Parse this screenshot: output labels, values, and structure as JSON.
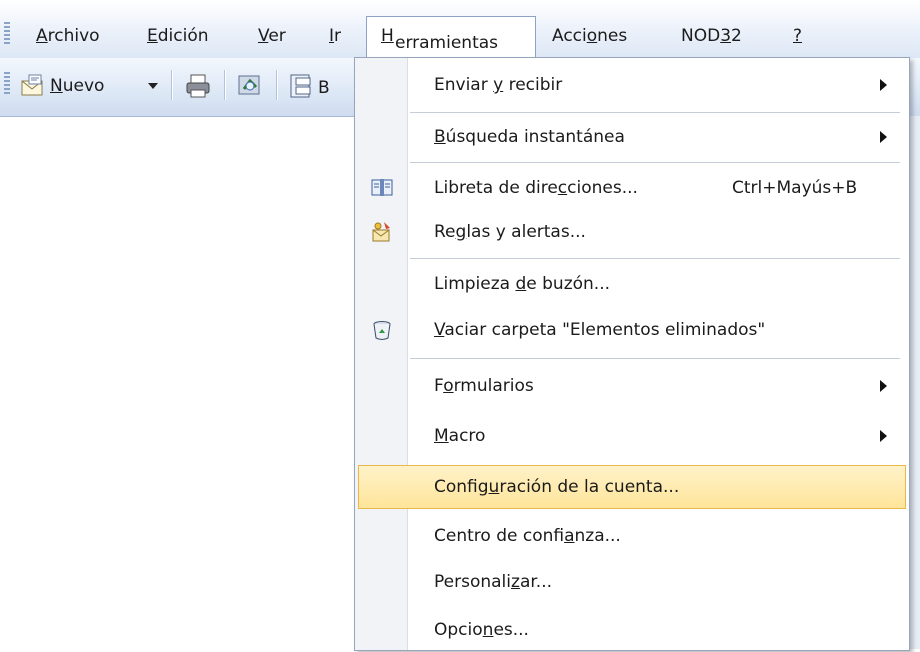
{
  "menubar": {
    "items": [
      {
        "pre": "",
        "u": "A",
        "post": "rchivo"
      },
      {
        "pre": "",
        "u": "E",
        "post": "dición"
      },
      {
        "pre": "",
        "u": "V",
        "post": "er"
      },
      {
        "pre": "",
        "u": "I",
        "post": "r"
      },
      {
        "pre": "",
        "u": "H",
        "post": "erramientas"
      },
      {
        "pre": "Acci",
        "u": "o",
        "post": "nes"
      },
      {
        "pre": "NOD",
        "u": "3",
        "post": "2"
      },
      {
        "pre": "",
        "u": "?",
        "post": ""
      }
    ]
  },
  "toolbar": {
    "new": {
      "pre": "",
      "u": "N",
      "post": "uevo"
    },
    "cut_text": "B"
  },
  "menu": {
    "items": [
      {
        "pre": "Enviar ",
        "u": "y",
        "post": " recibir",
        "shortcut": "",
        "submenu": true,
        "icon": "none"
      },
      {
        "pre": "",
        "u": "B",
        "post": "úsqueda instantánea",
        "shortcut": "",
        "submenu": true,
        "icon": "none"
      },
      {
        "pre": "Libreta de dire",
        "u": "c",
        "post": "ciones...",
        "shortcut": "Ctrl+Mayús+B",
        "submenu": false,
        "icon": "address-book-icon"
      },
      {
        "pre": "Re",
        "u": "g",
        "post": "las y alertas...",
        "shortcut": "",
        "submenu": false,
        "icon": "rules-icon"
      },
      {
        "pre": "Limpieza ",
        "u": "d",
        "post": "e buzón...",
        "shortcut": "",
        "submenu": false,
        "icon": "none"
      },
      {
        "pre": "",
        "u": "V",
        "post": "aciar carpeta \"Elementos eliminados\"",
        "shortcut": "",
        "submenu": false,
        "icon": "recycle-bin-icon"
      },
      {
        "pre": "F",
        "u": "o",
        "post": "rmularios",
        "shortcut": "",
        "submenu": true,
        "icon": "none"
      },
      {
        "pre": "",
        "u": "M",
        "post": "acro",
        "shortcut": "",
        "submenu": true,
        "icon": "none"
      },
      {
        "pre": "Config",
        "u": "u",
        "post": "ración de la cuenta...",
        "shortcut": "",
        "submenu": false,
        "icon": "none",
        "highlighted": true
      },
      {
        "pre": "Centro de confi",
        "u": "a",
        "post": "nza...",
        "shortcut": "",
        "submenu": false,
        "icon": "none"
      },
      {
        "pre": "Personali",
        "u": "z",
        "post": "ar...",
        "shortcut": "",
        "submenu": false,
        "icon": "none"
      },
      {
        "pre": "Opcio",
        "u": "n",
        "post": "es...",
        "shortcut": "",
        "submenu": false,
        "icon": "none"
      }
    ]
  },
  "colors": {
    "highlight": "#ffe59a",
    "highlight_border": "#e6b84d",
    "menubar": "#dde7f5"
  }
}
